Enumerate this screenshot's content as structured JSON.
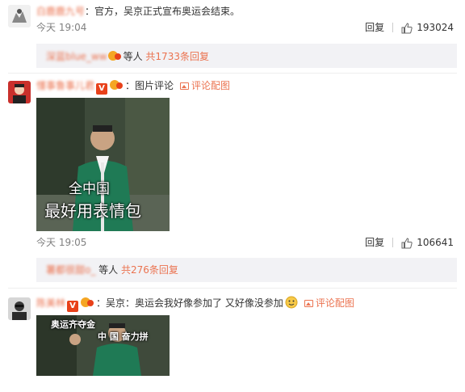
{
  "comments": [
    {
      "username": "白鹿鹿九号",
      "text": "：官方，吴京正式宣布奥运会结束。",
      "time": "今天 19:04",
      "reply_label": "回复",
      "likes": "193024",
      "replies_summary": {
        "user": "深蓝blue_ww",
        "middle": "等人",
        "count_text": "共1733条回复"
      }
    },
    {
      "username": "懂事鲁事儿君",
      "text": "：图片评论",
      "pic_link": "评论配图",
      "image": {
        "caption_line1": "全中国",
        "caption_line2": "最好用表情包"
      },
      "time": "今天 19:05",
      "reply_label": "回复",
      "likes": "106641",
      "replies_summary": {
        "user": "薯都很甜o_",
        "middle": "等人",
        "count_text": "共276条回复"
      }
    },
    {
      "username": "陈美林",
      "text": "：吴京：奥运会我好像参加了 又好像没参加",
      "pic_link": "评论配图",
      "image": {
        "caption_top": "奥运齐夺金",
        "caption_bottom": "中 国 奋力拼"
      }
    }
  ],
  "colors": {
    "link": "#eb7350",
    "meta": "#808080",
    "reply_box": "#f2f2f5",
    "v_badge": "#e8411a"
  },
  "icons": [
    "thumbs-up-icon",
    "image-icon",
    "v-badge-icon",
    "vip-badge-icon",
    "emoji-icon"
  ]
}
